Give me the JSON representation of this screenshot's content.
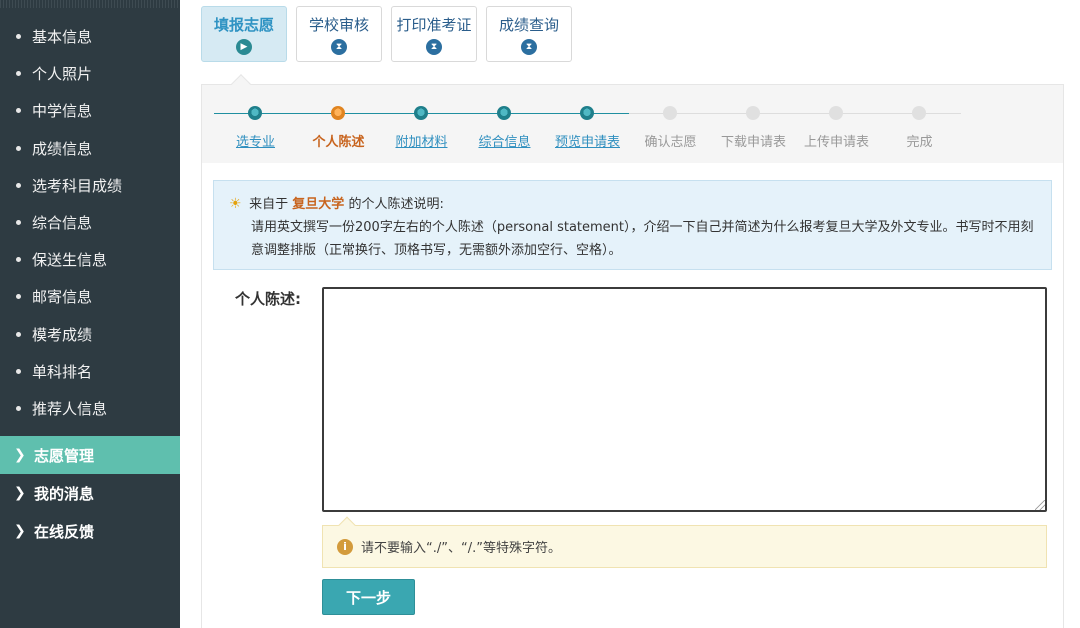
{
  "sidebar": {
    "sub_items": [
      {
        "label": "基本信息"
      },
      {
        "label": "个人照片"
      },
      {
        "label": "中学信息"
      },
      {
        "label": "成绩信息"
      },
      {
        "label": "选考科目成绩"
      },
      {
        "label": "综合信息"
      },
      {
        "label": "保送生信息"
      },
      {
        "label": "邮寄信息"
      },
      {
        "label": "模考成绩"
      },
      {
        "label": "单科排名"
      },
      {
        "label": "推荐人信息"
      }
    ],
    "main_items": [
      {
        "label": "志愿管理",
        "active": true
      },
      {
        "label": "我的消息"
      },
      {
        "label": "在线反馈"
      }
    ]
  },
  "tabs": [
    {
      "label": "填报志愿",
      "icon": "play-icon",
      "active": true
    },
    {
      "label": "学校审核",
      "icon": "hourglass-icon"
    },
    {
      "label": "打印准考证",
      "icon": "hourglass-icon"
    },
    {
      "label": "成绩查询",
      "icon": "hourglass-icon"
    }
  ],
  "steps": [
    {
      "label": "选专业",
      "state": "done"
    },
    {
      "label": "个人陈述",
      "state": "current"
    },
    {
      "label": "附加材料",
      "state": "done"
    },
    {
      "label": "综合信息",
      "state": "done"
    },
    {
      "label": "预览申请表",
      "state": "done"
    },
    {
      "label": "确认志愿",
      "state": "todo"
    },
    {
      "label": "下载申请表",
      "state": "todo"
    },
    {
      "label": "上传申请表",
      "state": "todo"
    },
    {
      "label": "完成",
      "state": "todo"
    }
  ],
  "notice": {
    "prefix": "来自于",
    "university": "复旦大学",
    "suffix": "的个人陈述说明:",
    "line1": "请用英文撰写一份200字左右的个人陈述（personal statement），介绍一下自己并简述为什么报考复旦大学及外文专业。书写时不用刻",
    "line2": "意调整排版（正常换行、顶格书写，无需额外添加空行、空格）。"
  },
  "form": {
    "label": "个人陈述:",
    "value": ""
  },
  "warning": {
    "text": "请不要输入“./”、“/.”等特殊字符。"
  },
  "next_button": {
    "label": "下一步"
  }
}
